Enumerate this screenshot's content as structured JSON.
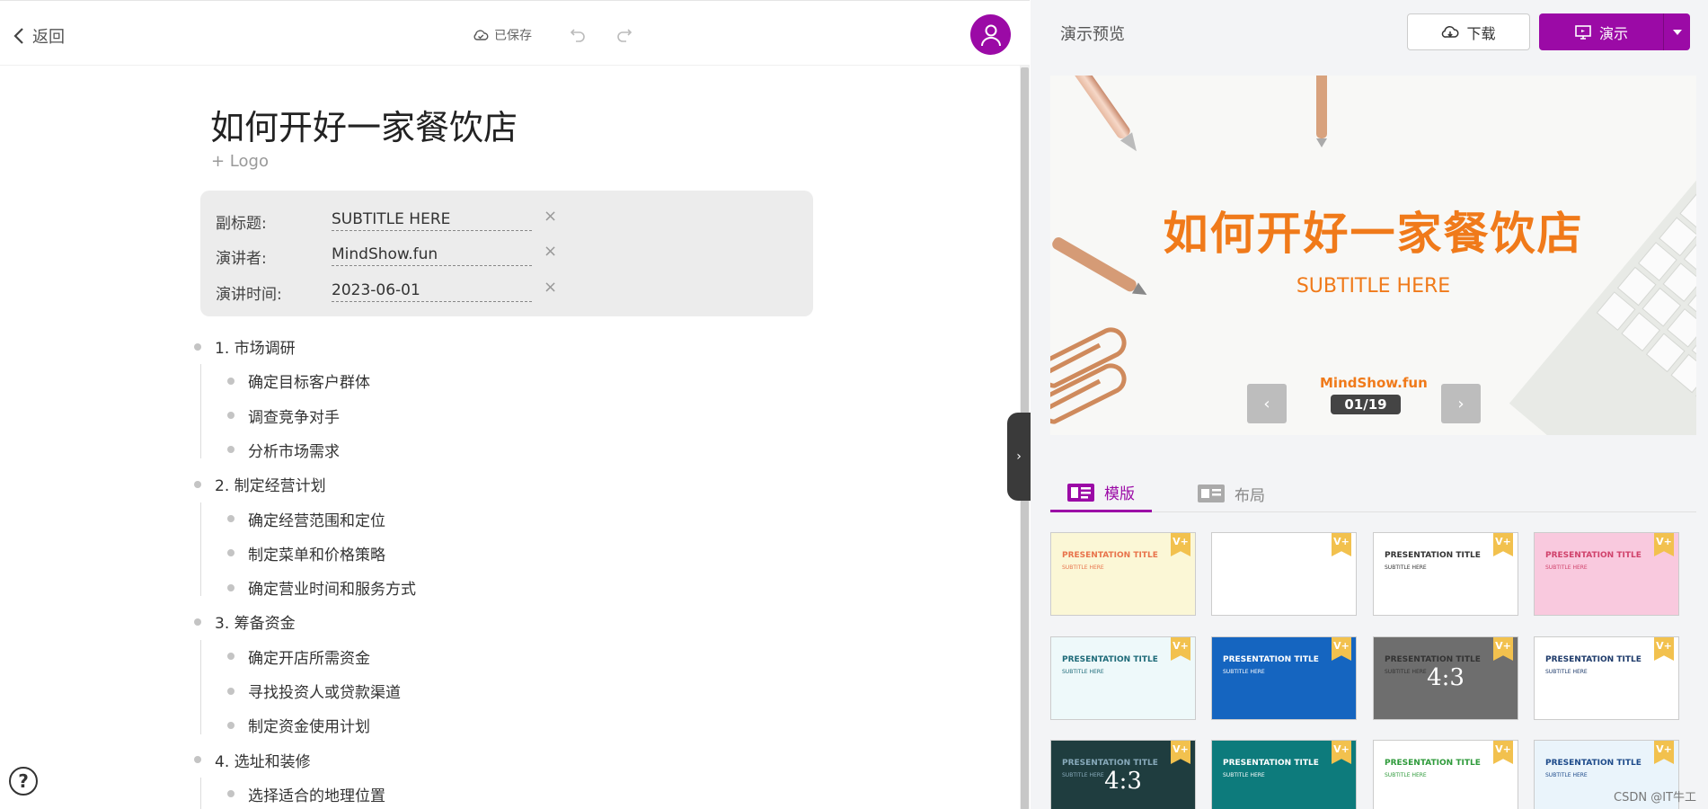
{
  "editor": {
    "back_label": "返回",
    "saved_label": "已保存",
    "title": "如何开好一家餐饮店",
    "add_logo": "+ Logo",
    "meta": [
      {
        "label": "副标题:",
        "value": "SUBTITLE HERE"
      },
      {
        "label": "演讲者:",
        "value": "MindShow.fun"
      },
      {
        "label": "演讲时间:",
        "value": "2023-06-01"
      }
    ],
    "outline": [
      {
        "text": "1. 市场调研",
        "level": 0
      },
      {
        "text": "确定目标客户群体",
        "level": 1
      },
      {
        "text": "调查竞争对手",
        "level": 1
      },
      {
        "text": "分析市场需求",
        "level": 1
      },
      {
        "text": "2. 制定经营计划",
        "level": 0
      },
      {
        "text": "确定经营范围和定位",
        "level": 1
      },
      {
        "text": "制定菜单和价格策略",
        "level": 1
      },
      {
        "text": "确定营业时间和服务方式",
        "level": 1
      },
      {
        "text": "3. 筹备资金",
        "level": 0
      },
      {
        "text": "确定开店所需资金",
        "level": 1
      },
      {
        "text": "寻找投资人或贷款渠道",
        "level": 1
      },
      {
        "text": "制定资金使用计划",
        "level": 1
      },
      {
        "text": "4. 选址和装修",
        "level": 0
      },
      {
        "text": "选择适合的地理位置",
        "level": 1
      }
    ],
    "help_glyph": "?"
  },
  "preview": {
    "title": "演示预览",
    "download_label": "下载",
    "present_label": "演示",
    "slide": {
      "title": "如何开好一家餐饮店",
      "subtitle": "SUBTITLE HERE",
      "author": "MindShow.fun",
      "pager": "01/19"
    },
    "tabs": {
      "templates": "模版",
      "layout": "布局"
    },
    "templates": [
      {
        "title": "PRESENTATION TITLE",
        "sub": "SUBTITLE HERE",
        "bg": "#fbf7d6",
        "color": "#e8734b",
        "ratio": ""
      },
      {
        "title": "",
        "sub": "",
        "bg": "#ffffff",
        "color": "#333333",
        "ratio": ""
      },
      {
        "title": "PRESENTATION TITLE",
        "sub": "SUBTITLE HERE",
        "bg": "#ffffff",
        "color": "#333333",
        "ratio": ""
      },
      {
        "title": "PRESENTATION TITLE",
        "sub": "SUBTITLE HERE",
        "bg": "#f9c9de",
        "color": "#d0426b",
        "ratio": ""
      },
      {
        "title": "PRESENTATION TITLE",
        "sub": "SUBTITLE HERE",
        "bg": "#eef9fa",
        "color": "#1d6a78",
        "ratio": ""
      },
      {
        "title": "PRESENTATION TITLE",
        "sub": "SUBTITLE HERE",
        "bg": "#1565c0",
        "color": "#ffffff",
        "ratio": ""
      },
      {
        "title": "PRESENTATION TITLE",
        "sub": "SUBTITLE HERE",
        "bg": "#6e6e6e",
        "color": "#333333",
        "ratio": "4:3"
      },
      {
        "title": "PRESENTATION TITLE",
        "sub": "SUBTITLE HERE",
        "bg": "#ffffff",
        "color": "#1d3a6a",
        "ratio": ""
      },
      {
        "title": "PRESENTATION TITLE",
        "sub": "SUBTITLE HERE",
        "bg": "#1f3d3f",
        "color": "#8ab",
        "ratio": "4:3"
      },
      {
        "title": "PRESENTATION TITLE",
        "sub": "SUBTITLE HERE",
        "bg": "#0d7b7c",
        "color": "#ffffff",
        "ratio": ""
      },
      {
        "title": "PRESENTATION TITLE",
        "sub": "SUBTITLE HERE",
        "bg": "#ffffff",
        "color": "#2e9a3a",
        "ratio": ""
      },
      {
        "title": "PRESENTATION TITLE",
        "sub": "SUBTITLE HERE",
        "bg": "#eaf4fb",
        "color": "#1d4a8a",
        "ratio": ""
      }
    ],
    "vip_badge": "V+"
  },
  "watermark": "CSDN @IT牛工",
  "colors": {
    "accent": "#9b0aa6",
    "slide_orange": "#f07a1a"
  }
}
